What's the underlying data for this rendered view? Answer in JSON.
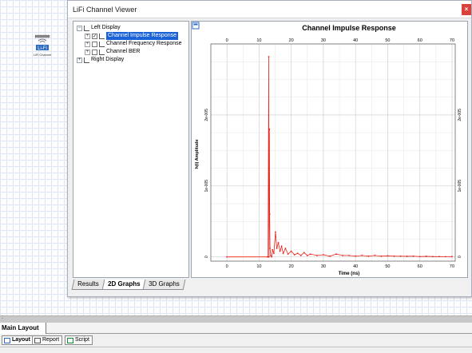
{
  "window": {
    "title": "LiFi Channel Viewer",
    "close": "×"
  },
  "component": {
    "label": "LiFi Channel"
  },
  "tree": {
    "items": [
      {
        "label": "Left Display",
        "expander": "−"
      },
      {
        "label": "Channel Impulse Response",
        "expander": "+",
        "checked": "✓"
      },
      {
        "label": "Channel Frequency Response",
        "expander": "+"
      },
      {
        "label": "Channel BER",
        "expander": "+"
      },
      {
        "label": "Right Display",
        "expander": "+"
      }
    ]
  },
  "tabs": [
    "Results",
    "2D Graphs",
    "3D Graphs"
  ],
  "main_tab": "Main Layout",
  "bottom_buttons": [
    "Layout",
    "Report",
    "Script"
  ],
  "scroll_mark": ":",
  "colors": {
    "series": "#e8241c",
    "selection": "#1a62d6"
  },
  "chart_data": {
    "type": "line",
    "title": "Channel Impulse Response",
    "xlabel": "Time (ns)",
    "ylabel": "h(t) Amplitude",
    "xlim": [
      -5,
      71
    ],
    "ylim": [
      -6e-07,
      3e-05
    ],
    "x_ticks": [
      0,
      10,
      20,
      30,
      40,
      50,
      60,
      70
    ],
    "x_tick_labels": [
      "0",
      "10",
      "20",
      "30",
      "40",
      "50",
      "60",
      "70"
    ],
    "y_ticks": [
      0,
      1e-05,
      2e-05
    ],
    "y_tick_labels": [
      "0",
      "1e-005",
      "2e-005"
    ],
    "grid": true,
    "series": [
      {
        "x": [
          0,
          12.6,
          12.8,
          13.0,
          13.1,
          13.2,
          13.3,
          13.4,
          13.6,
          13.9,
          14.2,
          14.6,
          15.1,
          15.5,
          16.0,
          16.5,
          17.0,
          17.5,
          18.2,
          19.0,
          20.0,
          21.0,
          22.0,
          23.0,
          24.0,
          25.0,
          26.0,
          28.0,
          30.0,
          32.0,
          34.0,
          36.0,
          38.0,
          40.0,
          42.0,
          44.0,
          46.0,
          48.0,
          50.0,
          52.0,
          54.0,
          56.0,
          58.0,
          60.0,
          62.0,
          64.0,
          66.0,
          68.0,
          70.0
        ],
        "y": [
          0,
          0,
          0,
          2.82e-05,
          0,
          1.8e-05,
          6e-06,
          1.2e-06,
          2e-07,
          0,
          1e-06,
          5e-07,
          3.5e-06,
          1.2e-06,
          2e-06,
          8e-07,
          1.5e-06,
          5e-07,
          1.2e-06,
          4e-07,
          8e-07,
          3e-07,
          5e-07,
          2e-07,
          6e-07,
          2e-07,
          4e-07,
          2e-07,
          3e-07,
          1e-07,
          4e-07,
          2e-07,
          2e-07,
          1e-07,
          2e-07,
          1e-07,
          2e-07,
          1e-07,
          1.5e-07,
          1e-07,
          1e-07,
          8e-08,
          1e-07,
          5e-08,
          8e-08,
          4e-08,
          5e-08,
          3e-08,
          4e-08
        ]
      }
    ]
  }
}
